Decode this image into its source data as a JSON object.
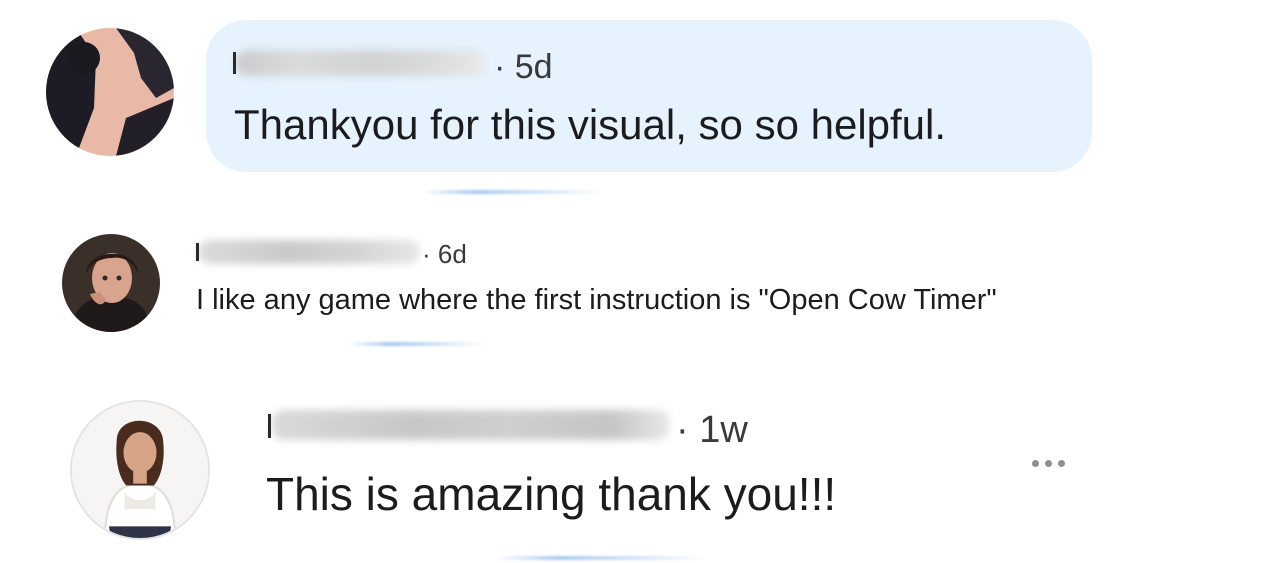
{
  "comments": [
    {
      "time": "· 5d",
      "text": "Thankyou for this visual, so so helpful.",
      "avatar": "dark-silhouette-avatar"
    },
    {
      "time": "· 6d",
      "text": "I like any game where the first instruction is \"Open Cow Timer\"",
      "avatar": "woman-portrait-avatar"
    },
    {
      "time": "· 1w",
      "text": "This is amazing thank you!!!",
      "avatar": "woman-white-sweater-avatar",
      "more_icon": "more-horizontal-icon"
    }
  ],
  "colors": {
    "bubble": "#e6f2fd",
    "text": "#1c1c1e",
    "meta": "#3a3a3c",
    "icon": "#8e8e93"
  }
}
